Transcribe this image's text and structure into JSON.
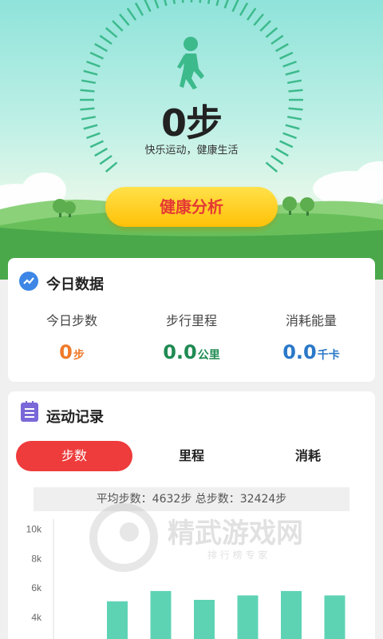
{
  "hero": {
    "steps_value": "0步",
    "slogan": "快乐运动，健康生活",
    "health_button": "健康分析"
  },
  "today": {
    "title": "今日数据",
    "stats": [
      {
        "label": "今日步数",
        "value": "0",
        "unit": "步",
        "color": "#ef7a2a"
      },
      {
        "label": "步行里程",
        "value": "0.0",
        "unit": "公里",
        "color": "#1e8a52"
      },
      {
        "label": "消耗能量",
        "value": "0.0",
        "unit": "千卡",
        "color": "#2a78c8"
      }
    ]
  },
  "records": {
    "title": "运动记录",
    "tabs": [
      "步数",
      "里程",
      "消耗"
    ],
    "active_tab": "步数",
    "summary": "平均步数：4632步 总步数：32424步"
  },
  "chart_data": {
    "type": "bar",
    "y_tick_labels": [
      "10k",
      "8k",
      "6k",
      "4k"
    ],
    "ylim": [
      2000,
      11000
    ],
    "values": [
      5100,
      5800,
      5200,
      5500,
      5800,
      5500
    ],
    "bar_color": "#5ed3b4"
  },
  "watermark": {
    "brand": "精武游戏网",
    "tagline": "排 行 榜 专 家"
  },
  "colors": {
    "accent_red": "#ee3b3b",
    "button_yellow": "#ffc107",
    "dial_green": "#3dba8c"
  }
}
